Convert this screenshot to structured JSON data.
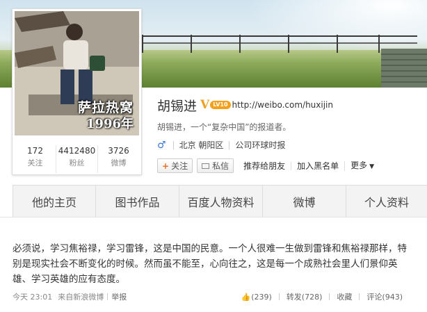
{
  "profile": {
    "name": "胡锡进",
    "verify_mark": "V",
    "level_badge": "LV10",
    "home_url": "http://weibo.com/huxijin",
    "intro": "胡锡进，一个“复杂中国”的报道者。",
    "gender_icon": "male-icon",
    "location": "北京 朝阳区",
    "company": "公司环球时报"
  },
  "avatar": {
    "caption_line1": "萨拉热窝",
    "caption_line2": "1996年"
  },
  "stats": [
    {
      "value": "172",
      "label": "关注"
    },
    {
      "value": "4412480",
      "label": "粉丝"
    },
    {
      "value": "3726",
      "label": "微博"
    }
  ],
  "actions": {
    "follow": "关注",
    "message": "私信",
    "recommend": "推荐给朋友",
    "blacklist": "加入黑名单",
    "more": "更多"
  },
  "tabs": [
    "他的主页",
    "图书作品",
    "百度人物资料",
    "微博",
    "个人资料"
  ],
  "post": {
    "text": "必须说，学习焦裕禄，学习雷锋，这是中国的民意。一个人很难一生做到雷锋和焦裕禄那样，特别是现实社会不断变化的时候。然而虽不能至，心向往之，这是每一个成熟社会里人们景仰英雄、学习英雄的应有态度。",
    "time": "今天 23:01",
    "source": "来自新浪微博",
    "report": "举报",
    "likes": "(239)",
    "repost": "转发(728)",
    "favorite": "收藏",
    "comment": "评论(943)"
  },
  "colors": {
    "accent_orange": "#e77023",
    "badge_orange": "#f3a11b",
    "link_blue": "#3b7bd1"
  }
}
